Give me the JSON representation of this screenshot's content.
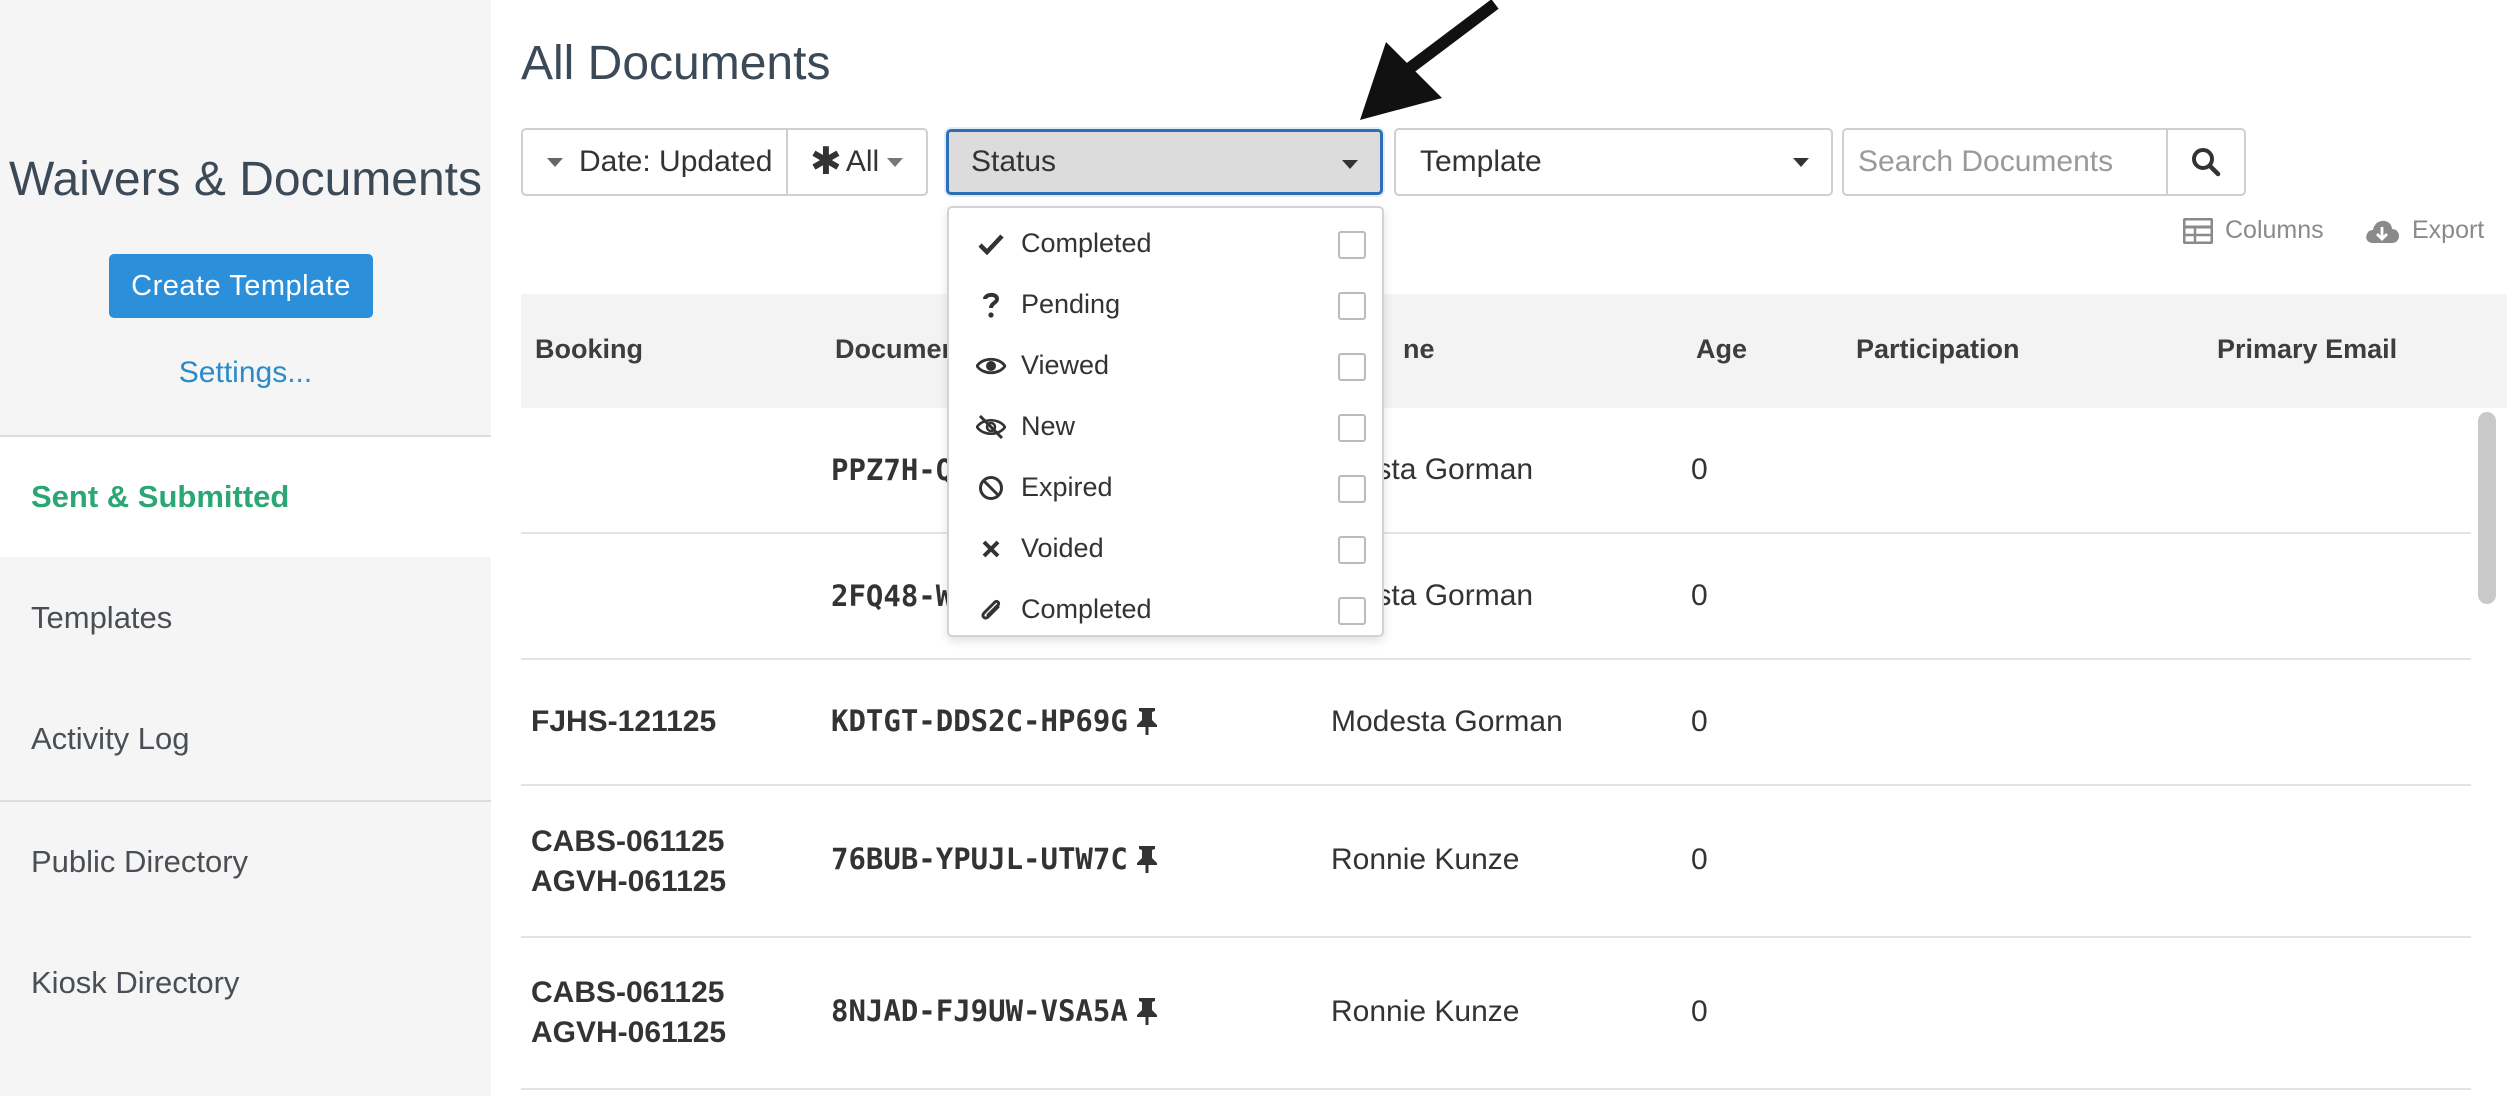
{
  "sidebar": {
    "title": "Waivers & Documents",
    "create_button": "Create Template",
    "settings_link": "Settings...",
    "nav": [
      {
        "label": "Sent & Submitted",
        "active": true
      },
      {
        "label": "Templates",
        "active": false
      },
      {
        "label": "Activity Log",
        "active": false
      },
      {
        "label": "Public Directory",
        "active": false
      },
      {
        "label": "Kiosk Directory",
        "active": false
      }
    ]
  },
  "main": {
    "title": "All Documents",
    "filters": {
      "date_label": "Date: Updated",
      "all_label": "All",
      "status_label": "Status",
      "template_label": "Template",
      "search_placeholder": "Search Documents"
    },
    "tools": {
      "columns": "Columns",
      "export": "Export"
    },
    "status_options": [
      {
        "label": "Completed",
        "icon": "check-icon",
        "checked": false
      },
      {
        "label": "Pending",
        "icon": "question-icon",
        "checked": false
      },
      {
        "label": "Viewed",
        "icon": "eye-icon",
        "checked": false
      },
      {
        "label": "New",
        "icon": "eye-slash-icon",
        "checked": false
      },
      {
        "label": "Expired",
        "icon": "ban-icon",
        "checked": false
      },
      {
        "label": "Voided",
        "icon": "times-icon",
        "checked": false
      },
      {
        "label": "Completed",
        "icon": "paperclip-icon",
        "checked": false
      }
    ],
    "table": {
      "columns": [
        "Booking",
        "Documen",
        "ne",
        "Age",
        "Participation",
        "Primary Email"
      ],
      "rows": [
        {
          "booking1": "",
          "booking2": "",
          "document": "PPZ7H-Q",
          "name": "desta Gorman",
          "age": "0",
          "pinned": false
        },
        {
          "booking1": "",
          "booking2": "",
          "document": "2FQ48-W",
          "name": "desta Gorman",
          "age": "0",
          "pinned": false
        },
        {
          "booking1": "FJHS-121125",
          "booking2": "",
          "document": "KDTGT-DDS2C-HP69G",
          "name": "Modesta Gorman",
          "age": "0",
          "pinned": true
        },
        {
          "booking1": "CABS-061125",
          "booking2": "AGVH-061125",
          "document": "76BUB-YPUJL-UTW7C",
          "name": "Ronnie Kunze",
          "age": "0",
          "pinned": true
        },
        {
          "booking1": "CABS-061125",
          "booking2": "AGVH-061125",
          "document": "8NJAD-FJ9UW-VSA5A",
          "name": "Ronnie Kunze",
          "age": "0",
          "pinned": true
        }
      ]
    }
  },
  "colors": {
    "accent_blue": "#2c8fd9",
    "active_green": "#2aa774",
    "sidebar_bg": "#f5f5f5"
  }
}
